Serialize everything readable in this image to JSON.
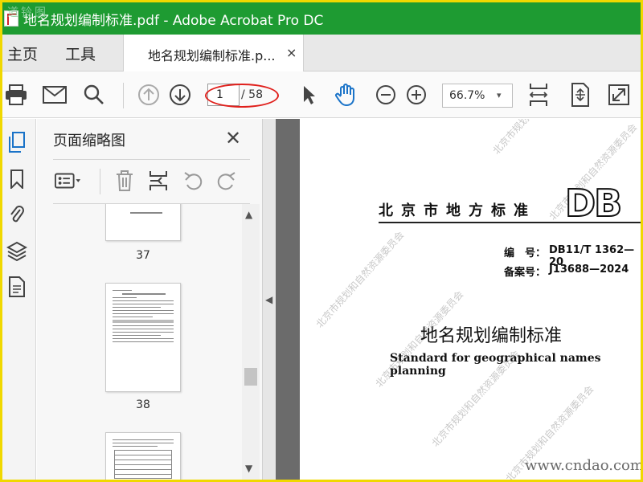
{
  "window": {
    "title": "地名规划编制标准.pdf - Adobe Acrobat Pro DC",
    "corner_watermark": "道铃图"
  },
  "nav_tabs": {
    "home": "主页",
    "tools": "工具"
  },
  "doc_tab": {
    "label": "地名规划编制标准.p...",
    "close": "×"
  },
  "toolbar": {
    "current_page": "1",
    "total_pages": "/ 58",
    "zoom": "66.7%",
    "zoom_caret": "▾"
  },
  "panel": {
    "title": "页面缩略图",
    "close": "✕",
    "thumbnails": [
      {
        "label": "37"
      },
      {
        "label": "38"
      }
    ]
  },
  "document": {
    "header": "北京市地方标准",
    "logo": "DB",
    "code_label": "编　号：",
    "code_value": "DB11/T 1362—20",
    "record_label": "备案号：",
    "record_value": "J13688—2024",
    "title_cn": "地名规划编制标准",
    "title_en": "Standard for geographical names planning",
    "watermark": "北京市规划和自然资源委员会"
  },
  "site_watermark": "www.cndao.com",
  "colors": {
    "titlebar": "#1e9b32",
    "outer_border": "#f0d800",
    "accent_blue": "#1a73c8",
    "annotation_red": "#e0201c"
  }
}
